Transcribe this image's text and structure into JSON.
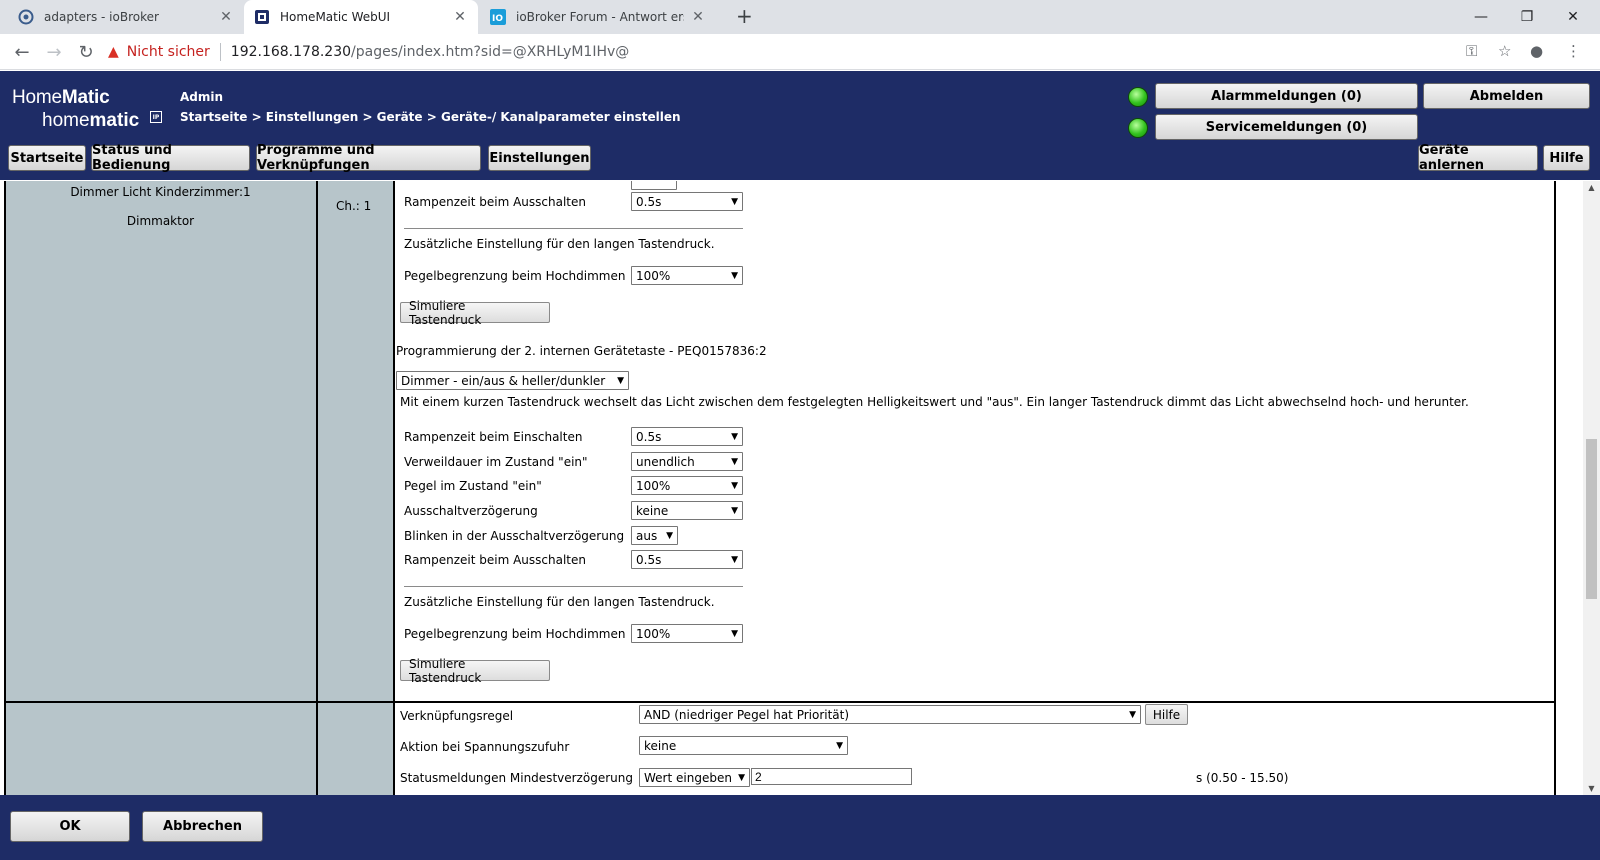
{
  "browser": {
    "tabs": [
      {
        "title": "adapters - ioBroker",
        "icon": "iobroker-gear-icon"
      },
      {
        "title": "HomeMatic WebUI",
        "icon": "homematic-icon"
      },
      {
        "title": "ioBroker Forum - Antwort erstelle",
        "icon": "io-forum-icon"
      }
    ],
    "security_label": "Nicht sicher",
    "url_host": "192.168.178.230",
    "url_path": "/pages/index.htm?sid=@XRHLyM1IHv@"
  },
  "header": {
    "logo_line1_a": "Home",
    "logo_line1_b": "Matic",
    "logo_line2_a": "home",
    "logo_line2_b": "matic",
    "logo_badge": "IP",
    "user": "Admin",
    "breadcrumb": "Startseite > Einstellungen > Geräte > Geräte-/ Kanalparameter einstellen",
    "alarm_button": "Alarmmeldungen (0)",
    "service_button": "Servicemeldungen (0)",
    "logout_button": "Abmelden",
    "nav": [
      "Startseite",
      "Status und Bedienung",
      "Programme und Verknüpfungen",
      "Einstellungen"
    ],
    "teach_button": "Geräte anlernen",
    "help_button": "Hilfe"
  },
  "device": {
    "name": "Dimmer Licht Kinderzimmer:1",
    "type": "Dimmaktor",
    "channel": "Ch.: 1"
  },
  "section1": {
    "ramp_off_label": "Rampenzeit beim Ausschalten",
    "ramp_off_value": "0.5s",
    "long_press_note": "Zusätzliche Einstellung für den langen Tastendruck.",
    "level_limit_label": "Pegelbegrenzung beim Hochdimmen",
    "level_limit_value": "100%",
    "simulate_button": "Simuliere Tastendruck"
  },
  "section2": {
    "heading": "Programmierung der 2. internen Gerätetaste - PEQ0157836:2",
    "profile_value": "Dimmer - ein/aus & heller/dunkler",
    "description": "Mit einem kurzen Tastendruck wechselt das Licht zwischen dem festgelegten Helligkeitswert und \"aus\". Ein langer Tastendruck dimmt das Licht abwechselnd hoch- und herunter.",
    "params": [
      {
        "label": "Rampenzeit beim Einschalten",
        "value": "0.5s"
      },
      {
        "label": "Verweildauer im Zustand \"ein\"",
        "value": "unendlich"
      },
      {
        "label": "Pegel im Zustand \"ein\"",
        "value": "100%"
      },
      {
        "label": "Ausschaltverzögerung",
        "value": "keine"
      },
      {
        "label": "Blinken in der Ausschaltverzögerung",
        "value": "aus"
      },
      {
        "label": "Rampenzeit beim Ausschalten",
        "value": "0.5s"
      }
    ],
    "long_press_note": "Zusätzliche Einstellung für den langen Tastendruck.",
    "level_limit_label": "Pegelbegrenzung beim Hochdimmen",
    "level_limit_value": "100%",
    "simulate_button": "Simuliere Tastendruck"
  },
  "section3": {
    "rule_label": "Verknüpfungsregel",
    "rule_value": "AND (niedriger Pegel hat Priorität)",
    "help_button": "Hilfe",
    "power_label": "Aktion bei Spannungszufuhr",
    "power_value": "keine",
    "status_label": "Statusmeldungen Mindestverzögerung",
    "status_mode": "Wert eingeben",
    "status_value": "2",
    "status_range": "s (0.50 - 15.50)"
  },
  "footer": {
    "ok_button": "OK",
    "cancel_button": "Abbrechen"
  }
}
